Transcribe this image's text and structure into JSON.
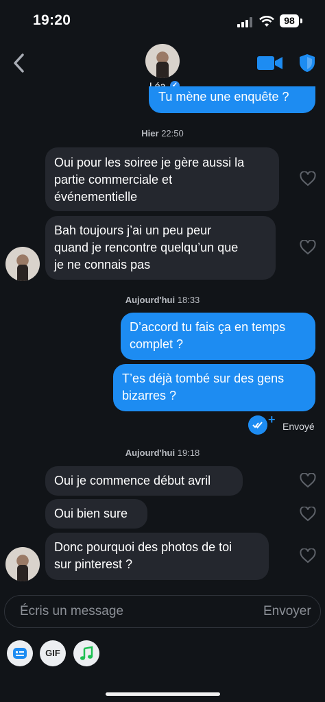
{
  "status": {
    "time": "19:20",
    "battery": "98"
  },
  "header": {
    "name": "Léa"
  },
  "messages": {
    "out_partial": "Tu mène une enquête ?",
    "ts1": {
      "day": "Hier",
      "time": "22:50"
    },
    "m1": [
      "Oui pour les soiree je gère aussi la",
      "partie commerciale et",
      "événementielle"
    ],
    "m2": [
      "Bah toujours j’ai un peu peur",
      "quand je rencontre quelqu’un que",
      "je ne connais pas"
    ],
    "ts2": {
      "day": "Aujourd'hui",
      "time": "18:33"
    },
    "o1": [
      "D’accord tu fais ça en temps",
      "complet ?"
    ],
    "o2": [
      "T’es déjà tombé sur des gens",
      "bizarres ?"
    ],
    "sent_label": "Envoyé",
    "ts3": {
      "day": "Aujourd'hui",
      "time": "19:18"
    },
    "m3": "Oui je commence début avril",
    "m4": "Oui bien sure",
    "m5": [
      "Donc pourquoi des photos de toi",
      "sur pinterest ?"
    ]
  },
  "composer": {
    "placeholder": "Écris un message",
    "send_label": "Envoyer"
  },
  "toolbar": {
    "gif_label": "GIF"
  },
  "colors": {
    "accent": "#1d8cf2",
    "incoming": "#24272e",
    "background": "#111418"
  },
  "icons": [
    "back-chevron-icon",
    "video-call-icon",
    "safety-shield-icon",
    "verified-badge-icon",
    "heart-icon",
    "sent-check-icon",
    "sticker-icon",
    "music-icon"
  ]
}
